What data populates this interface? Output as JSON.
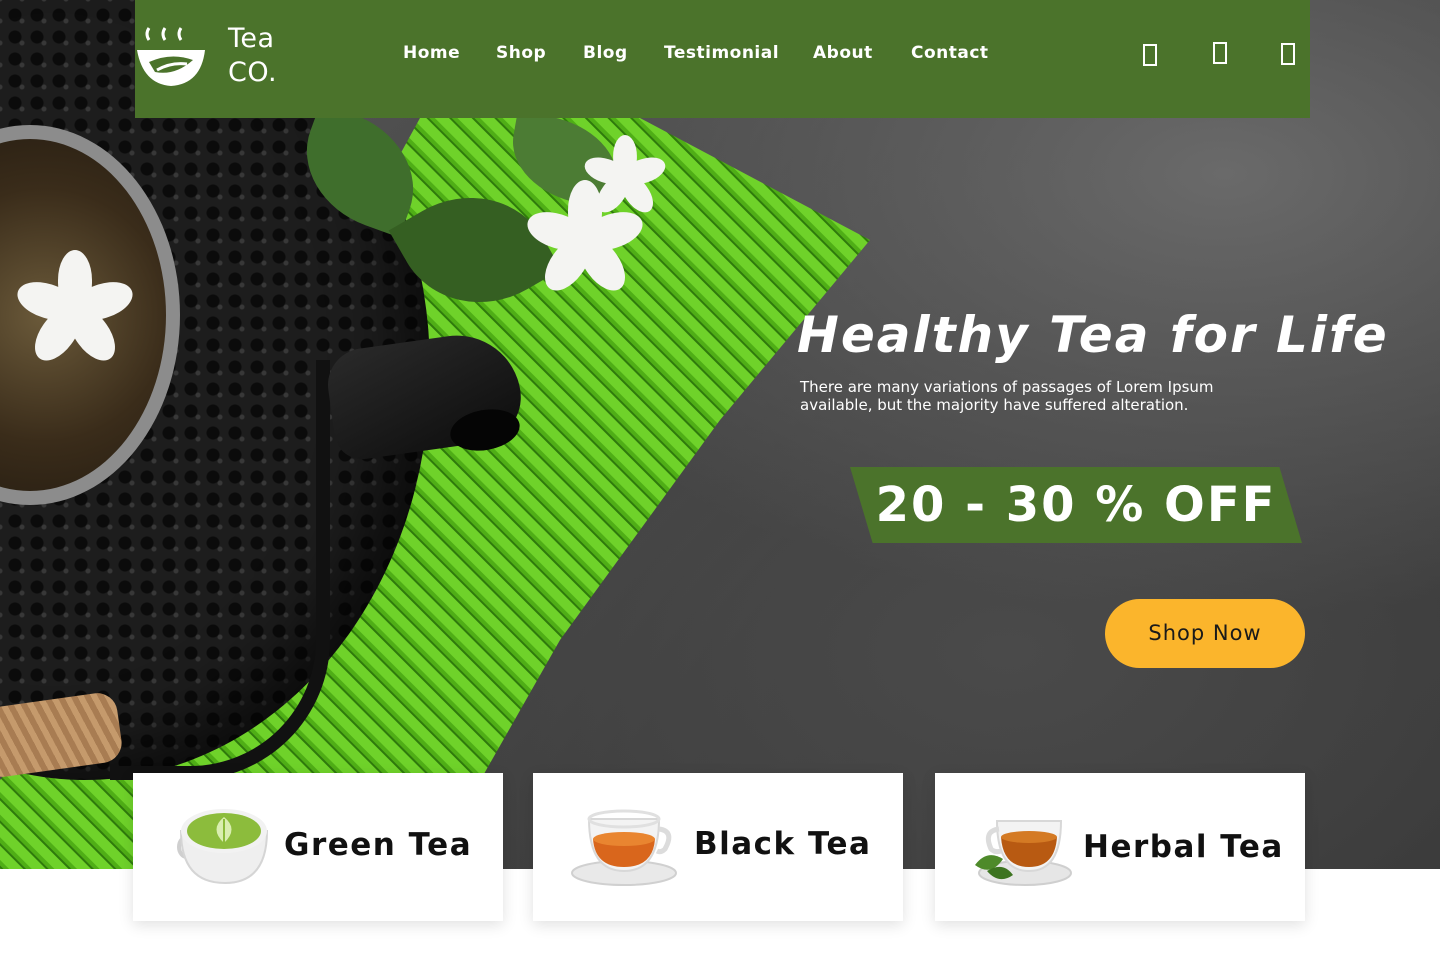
{
  "brand": {
    "logo_line1": "Tea",
    "logo_line2": "CO."
  },
  "nav": {
    "items": [
      {
        "label": "Home"
      },
      {
        "label": "Shop"
      },
      {
        "label": "Blog"
      },
      {
        "label": "Testimonial"
      },
      {
        "label": "About"
      },
      {
        "label": "Contact"
      }
    ],
    "icons": [
      "search-icon",
      "user-icon",
      "cart-icon"
    ]
  },
  "hero": {
    "headline": "Healthy Tea for Life",
    "subtext": "There are many variations of passages of Lorem Ipsum available, but the majority have suffered alteration.",
    "offer": "20 - 30 % OFF",
    "cta": "Shop Now"
  },
  "categories": [
    {
      "label": "Green Tea"
    },
    {
      "label": "Black Tea"
    },
    {
      "label": "Herbal Tea"
    }
  ],
  "colors": {
    "brand_green": "#4b732b",
    "accent_yellow": "#fbb52c",
    "mat_green": "#5fbf1f"
  }
}
